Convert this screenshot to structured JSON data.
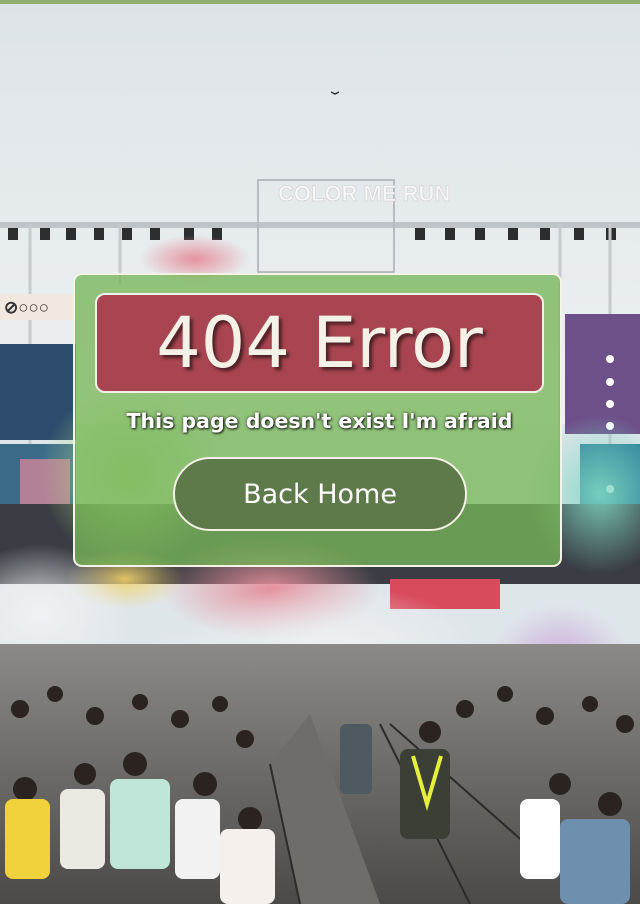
{
  "error": {
    "title": "404 Error",
    "message": "This page doesn't exist I'm afraid",
    "back_home_label": "Back Home"
  },
  "background": {
    "stage_sign": "COLOR ME RUN",
    "banner_text": "⊘○○○"
  },
  "colors": {
    "top_bar": "#8fae6f",
    "card_overlay": "#78b658",
    "title_bg": "#a84550",
    "button_bg": "#5f7a4a",
    "border": "#f3f0e6"
  }
}
